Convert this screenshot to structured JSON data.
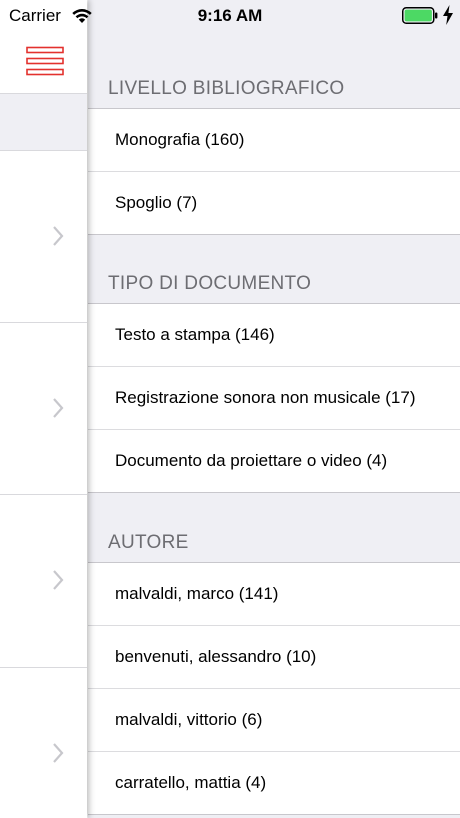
{
  "status_bar": {
    "carrier": "Carrier",
    "time": "9:16 AM",
    "wifi_icon": "wifi-icon",
    "battery_icon": "battery-icon",
    "charging_icon": "bolt-icon",
    "battery_color": "#4cd964"
  },
  "drawer": {
    "menu_icon": "hamburger-icon",
    "accent": "#e3312d",
    "chevron_icon": "chevron-right-icon"
  },
  "sections": [
    {
      "header": "LIVELLO BIBLIOGRAFICO",
      "items": [
        "Monografia (160)",
        "Spoglio (7)"
      ]
    },
    {
      "header": "TIPO DI DOCUMENTO",
      "items": [
        "Testo a stampa (146)",
        "Registrazione sonora non musicale (17)",
        "Documento da proiettare o video (4)"
      ]
    },
    {
      "header": "AUTORE",
      "items": [
        "malvaldi, marco (141)",
        "benvenuti, alessandro (10)",
        "malvaldi, vittorio (6)",
        "carratello, mattia (4)"
      ]
    }
  ]
}
